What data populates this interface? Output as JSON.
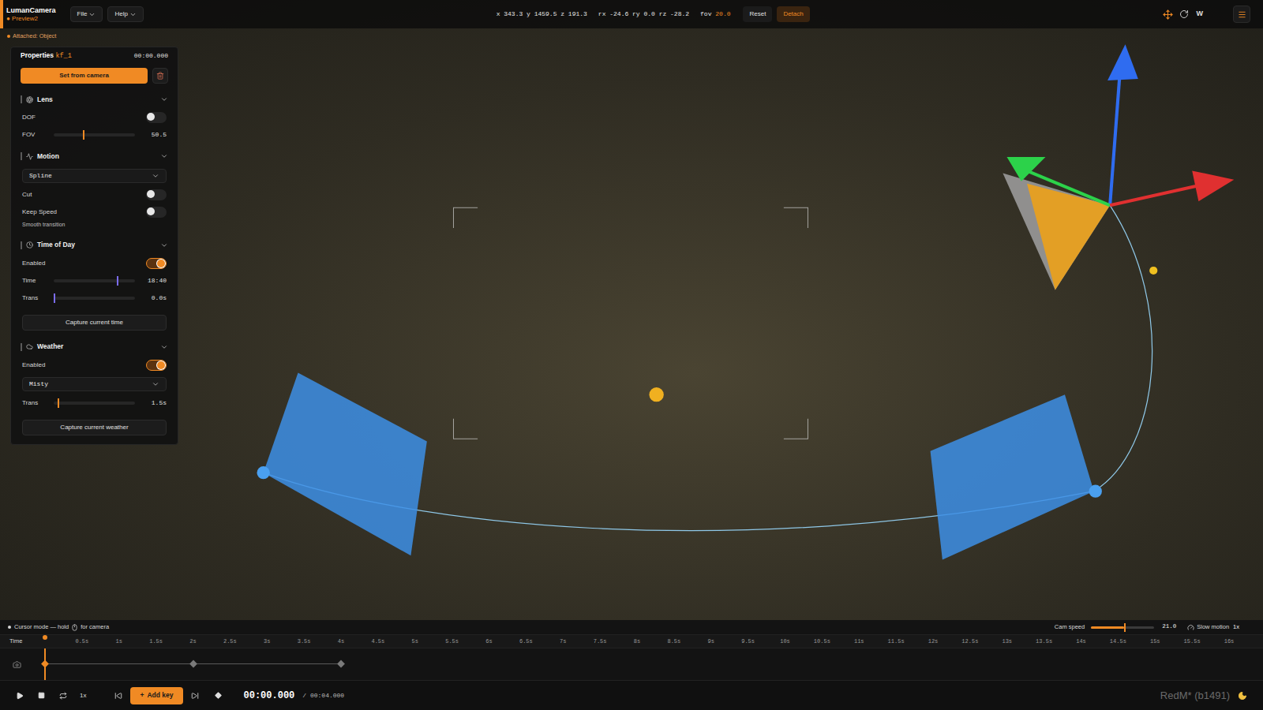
{
  "app": {
    "name": "LumanCamera",
    "project": "● Preview2"
  },
  "menus": [
    {
      "label": "File"
    },
    {
      "label": "Help"
    }
  ],
  "transform": {
    "position": "x 343.3 y 1459.5 z 191.3",
    "rotation": "rx -24.6 ry 0.0 rz -28.2",
    "fov_label": "fov",
    "fov_value": "20.0"
  },
  "actions": [
    {
      "label": "Reset",
      "highlighted": false
    },
    {
      "label": "Detach",
      "highlighted": true
    }
  ],
  "gizmo": {
    "move_selected": true,
    "rotate_selected": false,
    "space": "W"
  },
  "attached": "Attached: Object",
  "properties": {
    "title": "Properties",
    "keyframe": "kf_1",
    "time": "00:00.000",
    "set_button": "Set from camera",
    "sections": [
      {
        "title": "Lens",
        "expanded": true,
        "rows": [
          {
            "kind": "toggle",
            "label": "DOF",
            "on": false
          },
          {
            "kind": "slider",
            "label": "FOV",
            "level": 0.36,
            "reading": "50.5",
            "color": "#f08a24"
          }
        ]
      },
      {
        "title": "Motion",
        "expanded": true,
        "rows": [
          {
            "kind": "select",
            "value": "Spline"
          },
          {
            "kind": "toggle",
            "label": "Cut",
            "on": false
          },
          {
            "kind": "toggle",
            "label": "Keep Speed",
            "on": false
          },
          {
            "kind": "note",
            "label": "Smooth transition"
          }
        ]
      },
      {
        "title": "Time of Day",
        "expanded": true,
        "rows": [
          {
            "kind": "toggle",
            "label": "Enabled",
            "on": true
          },
          {
            "kind": "slider",
            "label": "Time",
            "level": 0.78,
            "reading": "18:40",
            "color": "#7b6cf0"
          },
          {
            "kind": "slider",
            "label": "Trans",
            "level": 0.0,
            "reading": "0.0s",
            "color": "#7b6cf0"
          },
          {
            "kind": "button",
            "label": "Capture current time"
          }
        ]
      },
      {
        "title": "Weather",
        "expanded": true,
        "rows": [
          {
            "kind": "toggle",
            "label": "Enabled",
            "on": true
          },
          {
            "kind": "select",
            "value": "Misty"
          },
          {
            "kind": "slider",
            "label": "Trans",
            "level": 0.05,
            "reading": "1.5s",
            "color": "#f08a24"
          },
          {
            "kind": "button",
            "label": "Capture current weather"
          }
        ]
      }
    ]
  },
  "status": {
    "hint_before": "Cursor mode — hold",
    "hint_after": "for camera",
    "cam_speed": {
      "label": "Cam speed",
      "level": 0.52,
      "reading": "21.0"
    },
    "slow_motion": {
      "label": "Slow motion",
      "value": "1x"
    }
  },
  "timeline": {
    "label": "Time",
    "ticks": [
      "0.5s",
      "1s",
      "1.5s",
      "2s",
      "2.5s",
      "3s",
      "3.5s",
      "4s",
      "4.5s",
      "5s",
      "5.5s",
      "6s",
      "6.5s",
      "7s",
      "7.5s",
      "8s",
      "8.5s",
      "9s",
      "9.5s",
      "10s",
      "10.5s",
      "11s",
      "11.5s",
      "12s",
      "12.5s",
      "13s",
      "13.5s",
      "14s",
      "14.5s",
      "15s",
      "15.5s",
      "16s"
    ],
    "playhead": 0,
    "keyframes": [
      {
        "time": 0,
        "selected": true
      },
      {
        "time": 2,
        "selected": false
      },
      {
        "time": 4,
        "selected": false
      }
    ]
  },
  "transport": {
    "speed": "1x",
    "add_icon": "+",
    "add_key": "Add key",
    "current": "00:00.000",
    "separator": "/",
    "duration": "00:04.000"
  },
  "build": "RedM* (b1491)"
}
